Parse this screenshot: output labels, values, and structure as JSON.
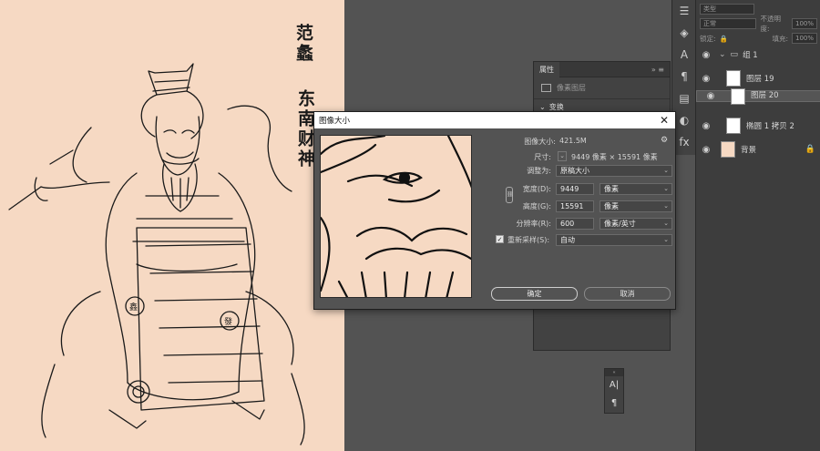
{
  "canvas": {
    "caption_left": "范蠡",
    "caption_right": "东南财神",
    "seal_left": "鑫",
    "seal_right": "發"
  },
  "layers_panel": {
    "filter_kind": "类型",
    "blend_mode": "正常",
    "opacity_label": "不透明度:",
    "opacity_value": "100%",
    "lock_label": "锁定:",
    "fill_label": "填充:",
    "fill_value": "100%",
    "layers": [
      {
        "name": "组 1",
        "type": "group"
      },
      {
        "name": "图层 19",
        "type": "layer"
      },
      {
        "name": "图层 20",
        "type": "layer",
        "selected": true
      },
      {
        "name": "椭圆 1 拷贝 2",
        "type": "layer"
      },
      {
        "name": "背景",
        "type": "background"
      }
    ]
  },
  "properties_panel": {
    "tab": "属性",
    "subtype": "像素图层",
    "section": "变换"
  },
  "dialog": {
    "title": "图像大小",
    "close": "✕",
    "image_size_label": "图像大小:",
    "image_size_value": "421.5M",
    "dimensions_label": "尺寸:",
    "dimensions_value": "9449 像素  ×  15591 像素",
    "fit_label": "调整为:",
    "fit_value": "原稿大小",
    "width_label": "宽度(D):",
    "width_value": "9449",
    "width_unit": "像素",
    "height_label": "高度(G):",
    "height_value": "15591",
    "height_unit": "像素",
    "resolution_label": "分辨率(R):",
    "resolution_value": "600",
    "resolution_unit": "像素/英寸",
    "resample_label": "重新采样(S):",
    "resample_value": "自动",
    "ok": "确定",
    "cancel": "取消"
  },
  "mini_panel": {
    "char_icon": "A|",
    "para_icon": "¶"
  },
  "icons": [
    "eye-icon",
    "folder-icon",
    "lock-icon",
    "gear-icon",
    "link-icon",
    "chevron-down-icon",
    "close-icon"
  ]
}
